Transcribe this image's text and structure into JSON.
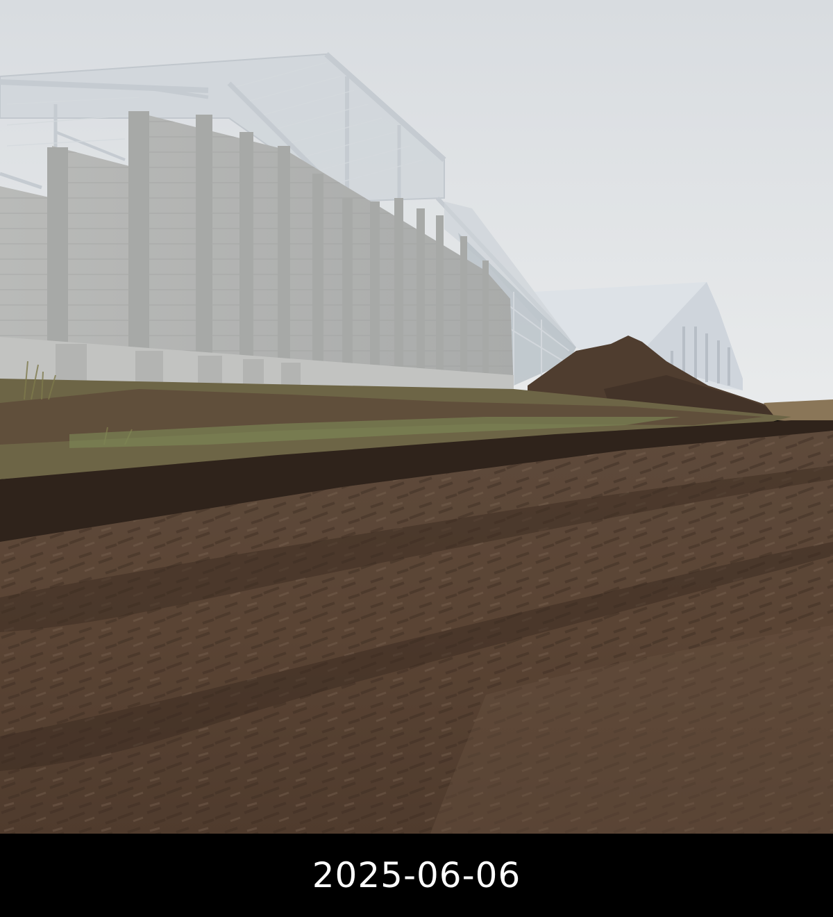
{
  "caption": {
    "date": "2025-06-06"
  },
  "colors": {
    "sky_top": "#d9dde1",
    "sky_bottom": "#e7e9eb",
    "steel_frame": "#c9ced3",
    "concrete_wall": "#b6b7b6",
    "concrete_pilaster": "#a9aaa8",
    "far_building": "#d8dde3",
    "soil_mound": "#4e3c2e",
    "grass_strip": "#6f6b4e",
    "mud_road": "#5a4435",
    "caption_bar": "#000000",
    "caption_text": "#ffffff"
  }
}
